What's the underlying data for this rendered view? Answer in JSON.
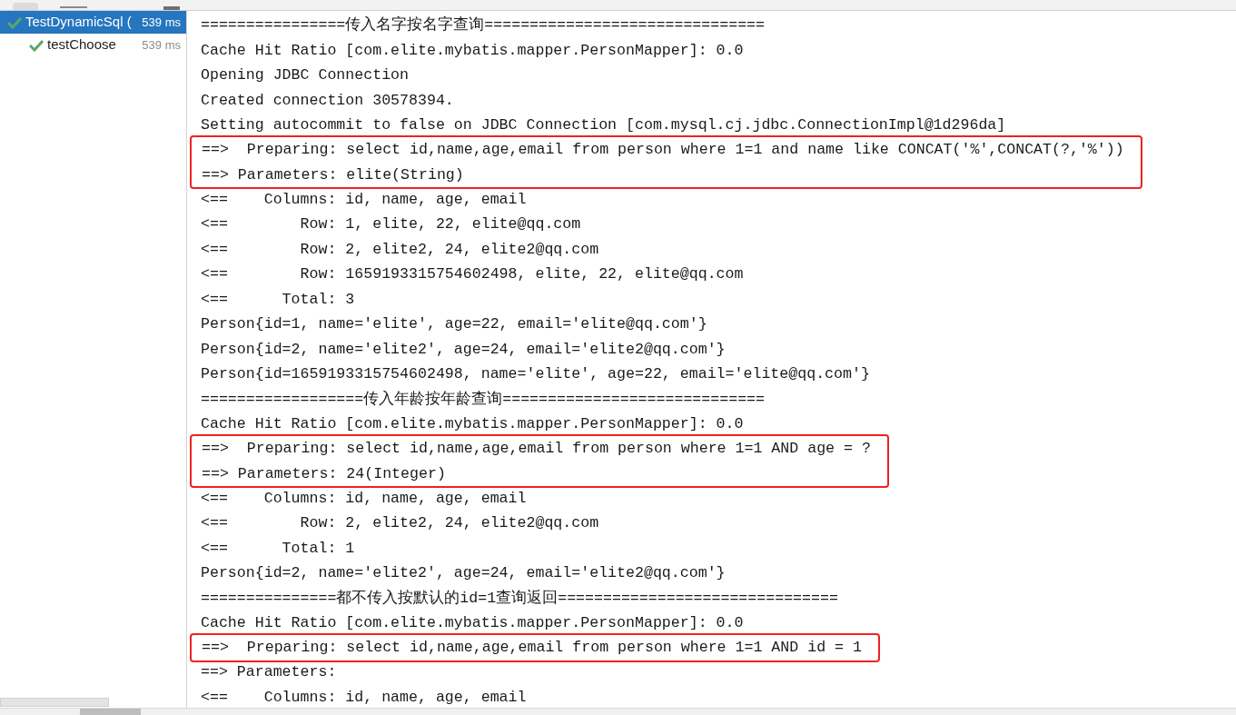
{
  "tests": [
    {
      "name": "TestDynamicSql (",
      "time": "539 ms",
      "passed": true,
      "selected": true,
      "children": [
        {
          "name": "testChoose",
          "time": "539 ms",
          "passed": true,
          "selected": false
        }
      ]
    }
  ],
  "console": [
    {
      "kind": "plain",
      "lines": [
        "================传入名字按名字查询===============================",
        "Cache Hit Ratio [com.elite.mybatis.mapper.PersonMapper]: 0.0",
        "Opening JDBC Connection",
        "Created connection 30578394.",
        "Setting autocommit to false on JDBC Connection [com.mysql.cj.jdbc.ConnectionImpl@1d296da]"
      ]
    },
    {
      "kind": "boxed",
      "lines": [
        "==>  Preparing: select id,name,age,email from person where 1=1 and name like CONCAT('%',CONCAT(?,'%'))",
        "==> Parameters: elite(String)"
      ]
    },
    {
      "kind": "plain",
      "lines": [
        "<==    Columns: id, name, age, email",
        "<==        Row: 1, elite, 22, elite@qq.com",
        "<==        Row: 2, elite2, 24, elite2@qq.com",
        "<==        Row: 1659193315754602498, elite, 22, elite@qq.com",
        "<==      Total: 3",
        "Person{id=1, name='elite', age=22, email='elite@qq.com'}",
        "Person{id=2, name='elite2', age=24, email='elite2@qq.com'}",
        "Person{id=1659193315754602498, name='elite', age=22, email='elite@qq.com'}",
        "==================传入年龄按年龄查询=============================",
        "Cache Hit Ratio [com.elite.mybatis.mapper.PersonMapper]: 0.0"
      ]
    },
    {
      "kind": "boxed",
      "lines": [
        "==>  Preparing: select id,name,age,email from person where 1=1 AND age = ?",
        "==> Parameters: 24(Integer)"
      ]
    },
    {
      "kind": "plain",
      "lines": [
        "<==    Columns: id, name, age, email",
        "<==        Row: 2, elite2, 24, elite2@qq.com",
        "<==      Total: 1",
        "Person{id=2, name='elite2', age=24, email='elite2@qq.com'}",
        "===============都不传入按默认的id=1查询返回===============================",
        "Cache Hit Ratio [com.elite.mybatis.mapper.PersonMapper]: 0.0"
      ]
    },
    {
      "kind": "boxed",
      "lines": [
        "==>  Preparing: select id,name,age,email from person where 1=1 AND id = 1"
      ]
    },
    {
      "kind": "plain",
      "lines": [
        "==> Parameters:",
        "<==    Columns: id, name, age, email"
      ]
    }
  ]
}
